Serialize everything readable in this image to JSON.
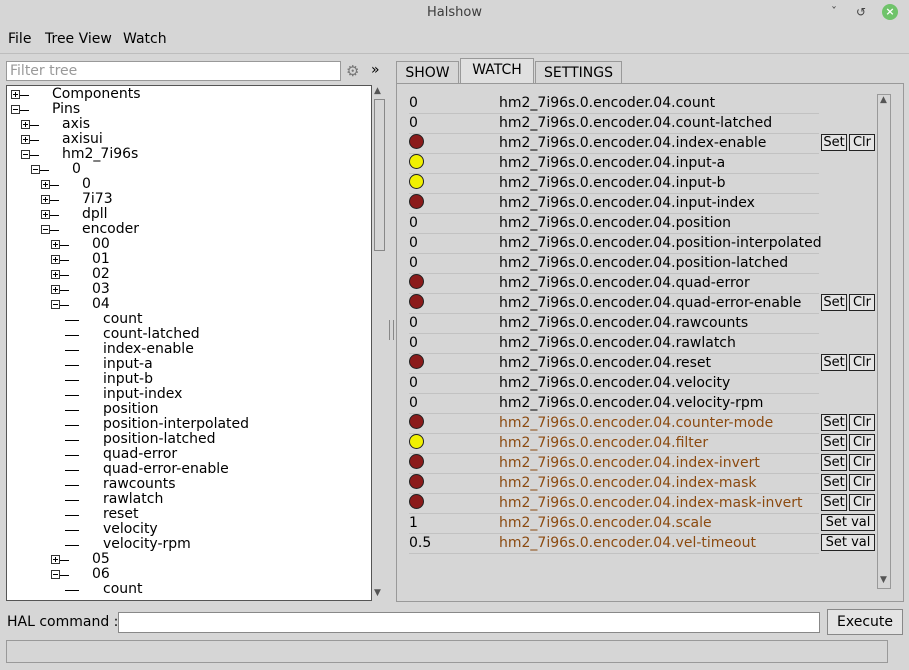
{
  "window": {
    "title": "Halshow",
    "minimize_icon": "ˇ",
    "maximize_icon": "↺",
    "close_icon": "×"
  },
  "menu": {
    "file": "File",
    "tree_view": "Tree View",
    "watch": "Watch"
  },
  "filter": {
    "placeholder": "Filter tree",
    "gear_icon": "⚙",
    "expand_icon": "»"
  },
  "tree": [
    {
      "label": "Components",
      "depth": 0,
      "node": "plus"
    },
    {
      "label": "Pins",
      "depth": 0,
      "node": "minus"
    },
    {
      "label": "axis",
      "depth": 1,
      "node": "plus"
    },
    {
      "label": "axisui",
      "depth": 1,
      "node": "plus"
    },
    {
      "label": "hm2_7i96s",
      "depth": 1,
      "node": "minus"
    },
    {
      "label": "0",
      "depth": 2,
      "node": "minus"
    },
    {
      "label": "0",
      "depth": 3,
      "node": "plus"
    },
    {
      "label": "7i73",
      "depth": 3,
      "node": "plus"
    },
    {
      "label": "dpll",
      "depth": 3,
      "node": "plus"
    },
    {
      "label": "encoder",
      "depth": 3,
      "node": "minus"
    },
    {
      "label": "00",
      "depth": 4,
      "node": "plus"
    },
    {
      "label": "01",
      "depth": 4,
      "node": "plus"
    },
    {
      "label": "02",
      "depth": 4,
      "node": "plus"
    },
    {
      "label": "03",
      "depth": 4,
      "node": "plus"
    },
    {
      "label": "04",
      "depth": 4,
      "node": "minus"
    },
    {
      "label": "count",
      "depth": 5,
      "node": "leaf"
    },
    {
      "label": "count-latched",
      "depth": 5,
      "node": "leaf"
    },
    {
      "label": "index-enable",
      "depth": 5,
      "node": "leaf"
    },
    {
      "label": "input-a",
      "depth": 5,
      "node": "leaf"
    },
    {
      "label": "input-b",
      "depth": 5,
      "node": "leaf"
    },
    {
      "label": "input-index",
      "depth": 5,
      "node": "leaf"
    },
    {
      "label": "position",
      "depth": 5,
      "node": "leaf"
    },
    {
      "label": "position-interpolated",
      "depth": 5,
      "node": "leaf"
    },
    {
      "label": "position-latched",
      "depth": 5,
      "node": "leaf"
    },
    {
      "label": "quad-error",
      "depth": 5,
      "node": "leaf"
    },
    {
      "label": "quad-error-enable",
      "depth": 5,
      "node": "leaf"
    },
    {
      "label": "rawcounts",
      "depth": 5,
      "node": "leaf"
    },
    {
      "label": "rawlatch",
      "depth": 5,
      "node": "leaf"
    },
    {
      "label": "reset",
      "depth": 5,
      "node": "leaf"
    },
    {
      "label": "velocity",
      "depth": 5,
      "node": "leaf"
    },
    {
      "label": "velocity-rpm",
      "depth": 5,
      "node": "leaf"
    },
    {
      "label": "05",
      "depth": 4,
      "node": "plus"
    },
    {
      "label": "06",
      "depth": 4,
      "node": "minus"
    },
    {
      "label": "count",
      "depth": 5,
      "node": "leaf"
    }
  ],
  "tabs": {
    "show": "SHOW",
    "watch": "WATCH",
    "settings": "SETTINGS"
  },
  "colors": {
    "led_off": "#8b1a1a",
    "led_on": "#f0f000",
    "param_text": "#8b4a10"
  },
  "buttons": {
    "set": "Set",
    "clr": "Clr",
    "set_val": "Set val"
  },
  "watch": [
    {
      "name": "hm2_7i96s.0.encoder.04.count",
      "kind": "value",
      "value": "0",
      "type": "pin",
      "btn": "none"
    },
    {
      "name": "hm2_7i96s.0.encoder.04.count-latched",
      "kind": "value",
      "value": "0",
      "type": "pin",
      "btn": "none"
    },
    {
      "name": "hm2_7i96s.0.encoder.04.index-enable",
      "kind": "led",
      "state": "off",
      "type": "pin",
      "btn": "setclr"
    },
    {
      "name": "hm2_7i96s.0.encoder.04.input-a",
      "kind": "led",
      "state": "on",
      "type": "pin",
      "btn": "none"
    },
    {
      "name": "hm2_7i96s.0.encoder.04.input-b",
      "kind": "led",
      "state": "on",
      "type": "pin",
      "btn": "none"
    },
    {
      "name": "hm2_7i96s.0.encoder.04.input-index",
      "kind": "led",
      "state": "off",
      "type": "pin",
      "btn": "none"
    },
    {
      "name": "hm2_7i96s.0.encoder.04.position",
      "kind": "value",
      "value": "0",
      "type": "pin",
      "btn": "none"
    },
    {
      "name": "hm2_7i96s.0.encoder.04.position-interpolated",
      "kind": "value",
      "value": "0",
      "type": "pin",
      "btn": "none"
    },
    {
      "name": "hm2_7i96s.0.encoder.04.position-latched",
      "kind": "value",
      "value": "0",
      "type": "pin",
      "btn": "none"
    },
    {
      "name": "hm2_7i96s.0.encoder.04.quad-error",
      "kind": "led",
      "state": "off",
      "type": "pin",
      "btn": "none"
    },
    {
      "name": "hm2_7i96s.0.encoder.04.quad-error-enable",
      "kind": "led",
      "state": "off",
      "type": "pin",
      "btn": "setclr"
    },
    {
      "name": "hm2_7i96s.0.encoder.04.rawcounts",
      "kind": "value",
      "value": "0",
      "type": "pin",
      "btn": "none"
    },
    {
      "name": "hm2_7i96s.0.encoder.04.rawlatch",
      "kind": "value",
      "value": "0",
      "type": "pin",
      "btn": "none"
    },
    {
      "name": "hm2_7i96s.0.encoder.04.reset",
      "kind": "led",
      "state": "off",
      "type": "pin",
      "btn": "setclr"
    },
    {
      "name": "hm2_7i96s.0.encoder.04.velocity",
      "kind": "value",
      "value": "0",
      "type": "pin",
      "btn": "none"
    },
    {
      "name": "hm2_7i96s.0.encoder.04.velocity-rpm",
      "kind": "value",
      "value": "0",
      "type": "pin",
      "btn": "none"
    },
    {
      "name": "hm2_7i96s.0.encoder.04.counter-mode",
      "kind": "led",
      "state": "off",
      "type": "param",
      "btn": "setclr"
    },
    {
      "name": "hm2_7i96s.0.encoder.04.filter",
      "kind": "led",
      "state": "on",
      "type": "param",
      "btn": "setclr"
    },
    {
      "name": "hm2_7i96s.0.encoder.04.index-invert",
      "kind": "led",
      "state": "off",
      "type": "param",
      "btn": "setclr"
    },
    {
      "name": "hm2_7i96s.0.encoder.04.index-mask",
      "kind": "led",
      "state": "off",
      "type": "param",
      "btn": "setclr"
    },
    {
      "name": "hm2_7i96s.0.encoder.04.index-mask-invert",
      "kind": "led",
      "state": "off",
      "type": "param",
      "btn": "setclr"
    },
    {
      "name": "hm2_7i96s.0.encoder.04.scale",
      "kind": "value",
      "value": "1",
      "type": "param",
      "btn": "setval"
    },
    {
      "name": "hm2_7i96s.0.encoder.04.vel-timeout",
      "kind": "value",
      "value": "0.5",
      "type": "param",
      "btn": "setval"
    }
  ],
  "hal": {
    "label": "HAL command :",
    "value": "",
    "execute": "Execute"
  },
  "status": {
    "text": ""
  }
}
